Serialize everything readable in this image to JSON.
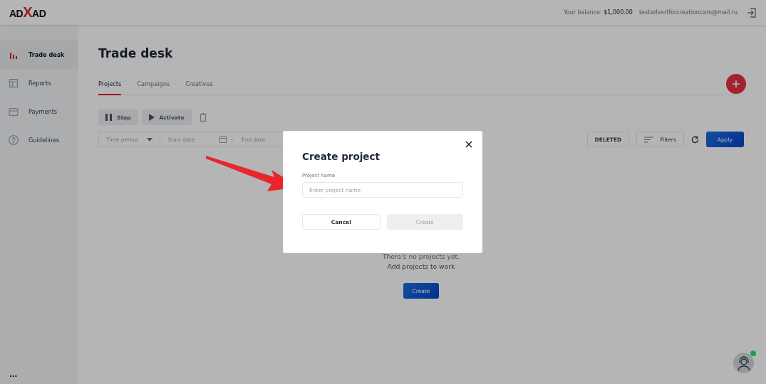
{
  "header": {
    "logo": {
      "left": "AD",
      "mark": "X",
      "right": "AD"
    },
    "balance_label": "Your balance:",
    "balance": "$1,000.00",
    "email": "testadvertforcreationcam@mail.ru"
  },
  "sidebar": {
    "items": [
      {
        "label": "Trade desk",
        "selected": true
      },
      {
        "label": "Reports",
        "selected": false
      },
      {
        "label": "Payments",
        "selected": false
      },
      {
        "label": "Guidelines",
        "selected": false
      }
    ],
    "more": "..."
  },
  "page": {
    "title": "Trade desk",
    "tabs": [
      {
        "label": "Projects",
        "selected": true
      },
      {
        "label": "Campaigns",
        "selected": false
      },
      {
        "label": "Creatives",
        "selected": false
      }
    ],
    "actions": [
      {
        "label": "Stop",
        "disabled": true
      },
      {
        "label": "Activate",
        "disabled": true
      }
    ],
    "filters": {
      "time_period": "Time period",
      "start_placeholder": "Start date",
      "end_placeholder": "End date",
      "dash": "–",
      "deleted": "DELETED",
      "filters": "Filters",
      "apply": "Apply"
    },
    "empty": {
      "line_1": "There's no projects yet.",
      "line_2": "Add projects to work",
      "button": "Create"
    }
  },
  "support": {
    "online": true
  },
  "modal": {
    "title": "Create project",
    "field_label": "Project name",
    "placeholder": "Enter project name",
    "cancel": "Cancel",
    "create": "Create",
    "create_disabled": true
  }
}
